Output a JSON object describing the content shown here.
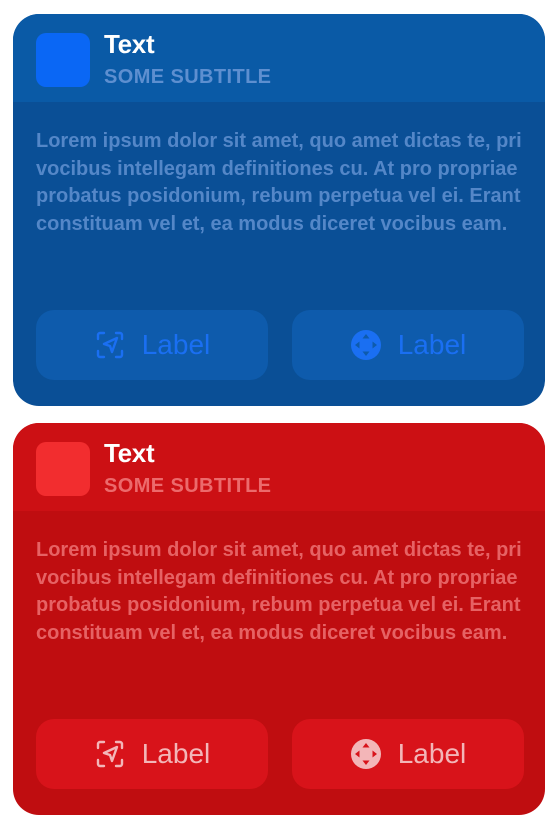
{
  "cards": [
    {
      "theme": "blue",
      "accent_color": "#0a67f5",
      "title": "Text",
      "subtitle": "SOME SUBTITLE",
      "body": "Lorem ipsum dolor sit amet, quo amet dictas te, pri vocibus intellegam definitiones cu. At pro propriae probatus posidonium, rebum perpetua vel ei. Erant constituam vel et, ea modus diceret vocibus eam.",
      "buttons": [
        {
          "label": "Label",
          "icon": "location-viewfinder-icon"
        },
        {
          "label": "Label",
          "icon": "dpad-circle-icon"
        }
      ]
    },
    {
      "theme": "red",
      "accent_color": "#f22d2f",
      "title": "Text",
      "subtitle": "SOME SUBTITLE",
      "body": "Lorem ipsum dolor sit amet, quo amet dictas te, pri vocibus intellegam definitiones cu. At pro propriae probatus posidonium, rebum perpetua vel ei. Erant constituam vel et, ea modus diceret vocibus eam.",
      "buttons": [
        {
          "label": "Label",
          "icon": "location-viewfinder-icon"
        },
        {
          "label": "Label",
          "icon": "dpad-circle-icon"
        }
      ]
    }
  ]
}
